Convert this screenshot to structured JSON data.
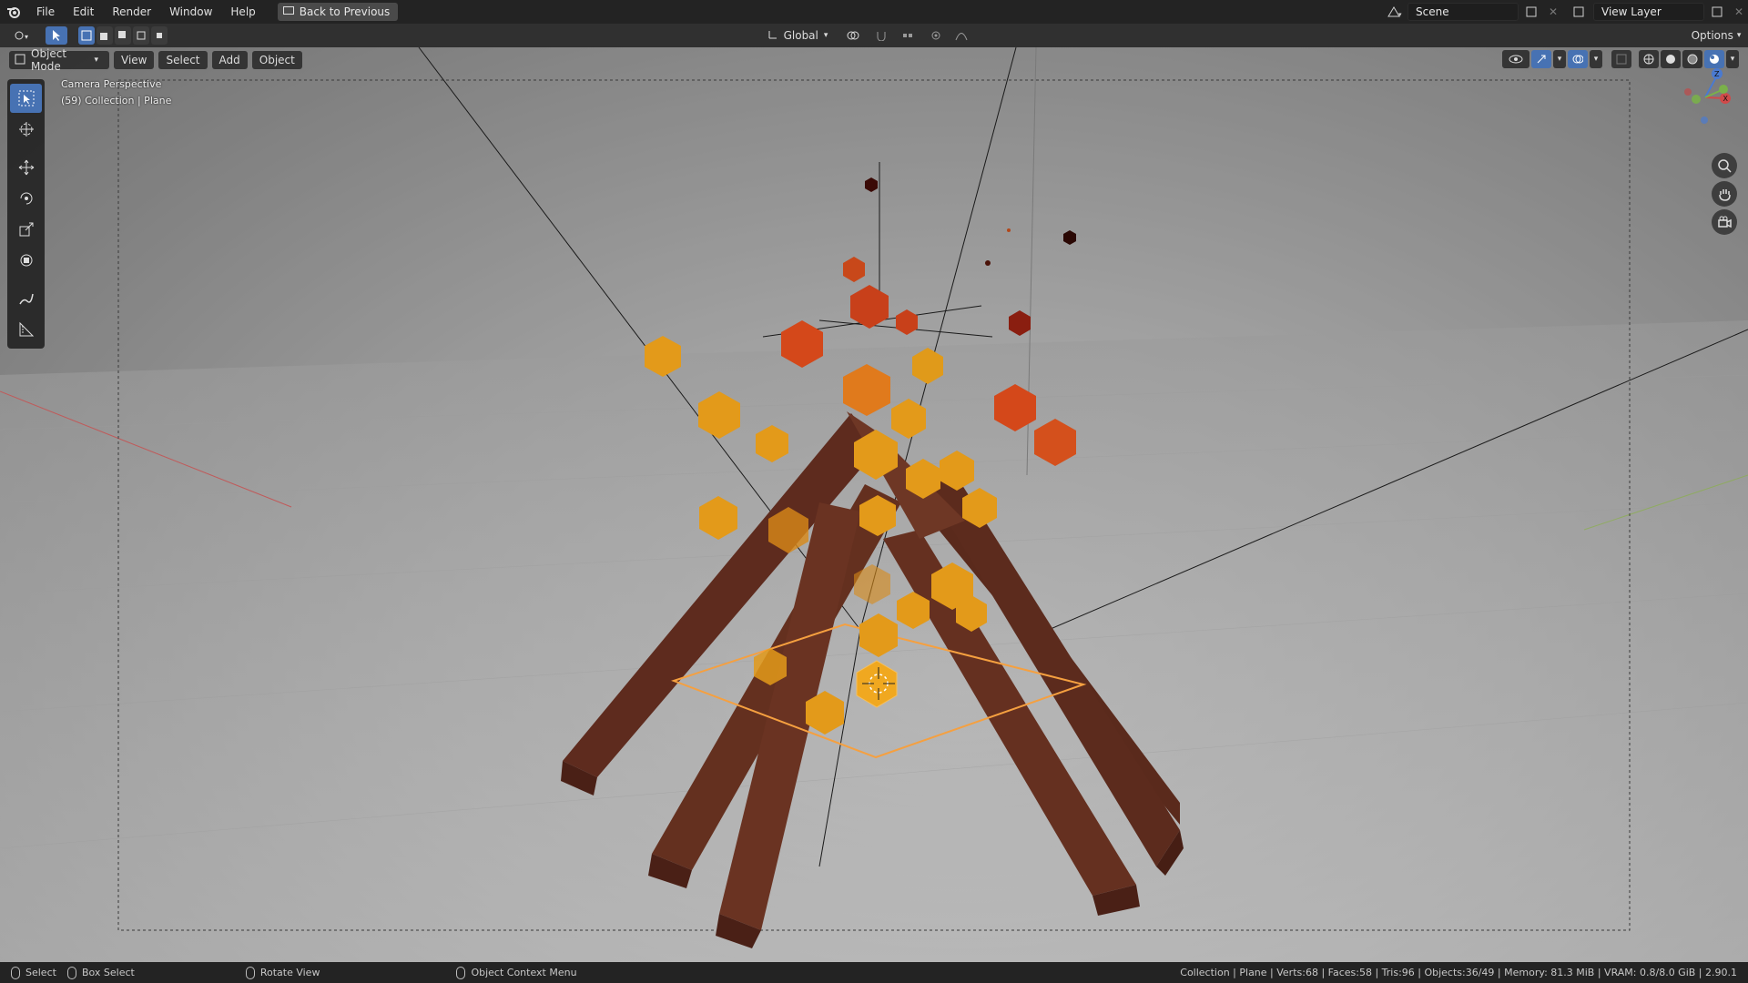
{
  "menu": {
    "file": "File",
    "edit": "Edit",
    "render": "Render",
    "window": "Window",
    "help": "Help"
  },
  "back_to_previous": "Back to Previous",
  "scene": {
    "label": "Scene"
  },
  "view_layer": {
    "label": "View Layer"
  },
  "header": {
    "transform_orientation": "Global",
    "options": "Options",
    "mode": "Object Mode",
    "view": "View",
    "select": "Select",
    "add": "Add",
    "object": "Object"
  },
  "viewport": {
    "camera_label": "Camera Perspective",
    "collection_label": "(59) Collection | Plane",
    "gizmo_axes": [
      "Z",
      "Y",
      "X"
    ]
  },
  "statusbar": {
    "select": "Select",
    "box_select": "Box Select",
    "rotate_view": "Rotate View",
    "object_context_menu": "Object Context Menu",
    "stats": "Collection | Plane | Verts:68 | Faces:58 | Tris:96 | Objects:36/49 | Memory: 81.3 MiB | VRAM: 0.8/8.0 GiB | 2.90.1"
  },
  "colors": {
    "accent_blue": "#4772b3",
    "wood": "#5a2a1e",
    "ember_orange": "#e0961a",
    "ember_red": "#d4481a",
    "selection_outline": "#f5a040"
  }
}
